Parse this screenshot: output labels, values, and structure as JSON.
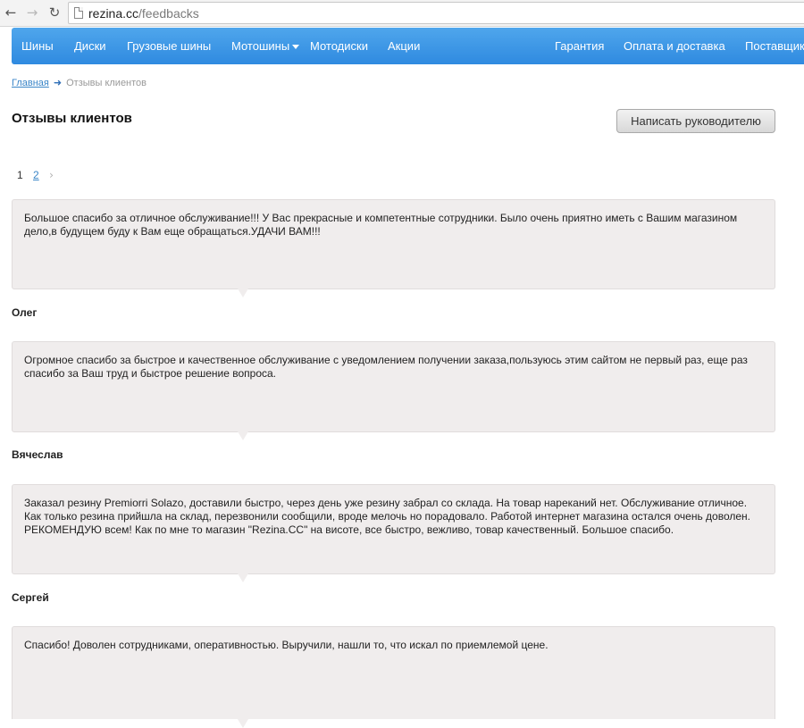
{
  "browser": {
    "url_domain": "rezina.cc",
    "url_path": "/feedbacks"
  },
  "icons": {
    "back": "arrow-left-icon",
    "forward": "arrow-right-icon",
    "reload": "reload-icon",
    "page": "page-icon",
    "dropdown": "caret-down-icon",
    "next_page": "chevron-right-icon"
  },
  "colors": {
    "nav_top": "#4fa6ec",
    "nav_bottom": "#2f8ae0",
    "link": "#3b86c8",
    "card_bg": "#f0eded"
  },
  "nav": {
    "items": [
      "Шины",
      "Диски",
      "Грузовые шины",
      "Мотошины",
      "Мотодиски",
      "Акции",
      "Гарантия",
      "Оплата и доставка",
      "Поставщик"
    ]
  },
  "breadcrumb": {
    "home": "Главная",
    "current": "Отзывы клиентов"
  },
  "page": {
    "title": "Отзывы клиентов",
    "write_button": "Написать руководителю"
  },
  "pagination": {
    "current": "1",
    "pages": [
      "2"
    ]
  },
  "feedbacks": [
    {
      "text": "Большое спасибо за отличное обслуживание!!! У Вас прекрасные и компетентные сотрудники. Было очень приятно иметь с Вашим магазином дело,в будущем буду к Вам еще обращаться.УДАЧИ ВАМ!!!",
      "author": "Олег"
    },
    {
      "text": "Огромное спасибо за быстрое и качественное обслуживание с уведомлением получении заказа,пользуюсь этим сайтом не первый раз, еще раз спасибо за Ваш труд и быстрое решение вопроса.",
      "author": "Вячеслав"
    },
    {
      "text": "Заказал резину Premiorri Solazo, доставили быстро, через день уже резину забрал со склада. На товар нареканий нет. Обслуживание отличное. Как только резина прийшла на склад, перезвонили сообщили, вроде мелочь но порадовало. Работой интернет магазина остался очень доволен. РЕКОМЕНДУЮ всем! Как по мне то магазин \"Rezina.CC\" на висоте, все быстро, вежливо, товар качественный. Большое спасибо.",
      "author": "Сергей"
    },
    {
      "text": "Спасибо! Доволен сотрудниками, оперативностью. Выручили, нашли то, что искал по приемлемой цене.",
      "author": ""
    }
  ]
}
